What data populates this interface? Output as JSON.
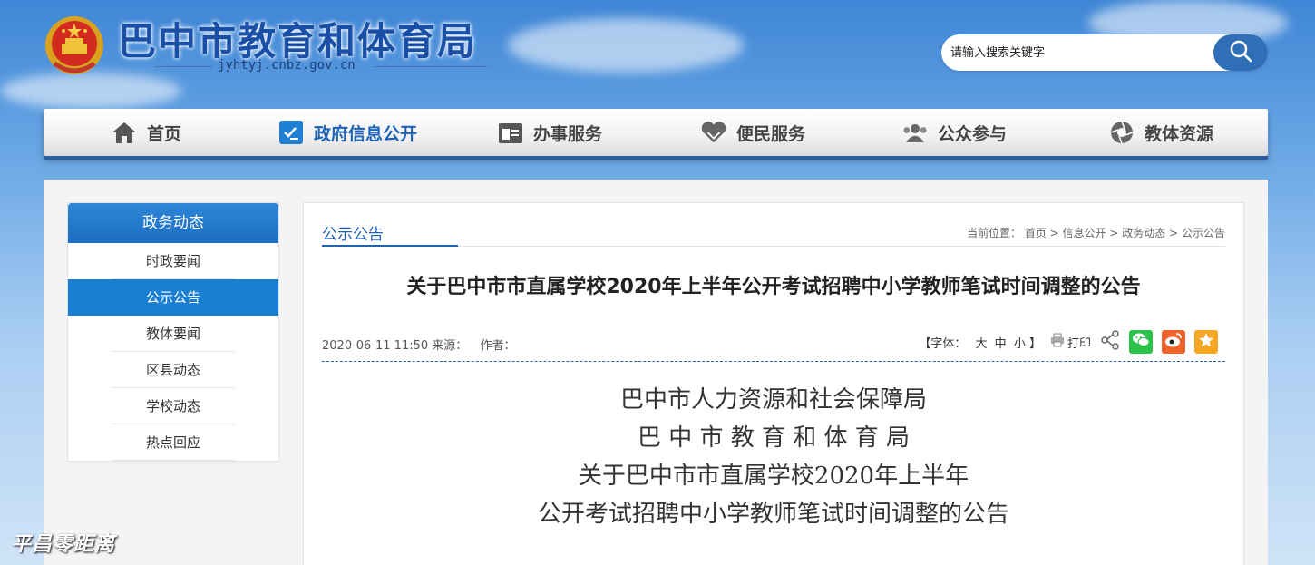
{
  "header": {
    "site_title": "巴中市教育和体育局",
    "site_domain": "jyhtyj.cnbz.gov.cn",
    "emblem_icon": "national-emblem-icon",
    "search": {
      "placeholder": "请输入搜索关键字",
      "button_icon": "search-icon"
    }
  },
  "nav": {
    "items": [
      {
        "label": "首页",
        "icon": "home-icon",
        "active": false
      },
      {
        "label": "政府信息公开",
        "icon": "doc-check-icon",
        "active": true
      },
      {
        "label": "办事服务",
        "icon": "folder-icon",
        "active": false
      },
      {
        "label": "便民服务",
        "icon": "heart-hands-icon",
        "active": false
      },
      {
        "label": "公众参与",
        "icon": "users-icon",
        "active": false
      },
      {
        "label": "教体资源",
        "icon": "aperture-icon",
        "active": false
      }
    ]
  },
  "sidebar": {
    "heading": "政务动态",
    "items": [
      {
        "label": "时政要闻",
        "active": false
      },
      {
        "label": "公示公告",
        "active": true
      },
      {
        "label": "教体要闻",
        "active": false
      },
      {
        "label": "区县动态",
        "active": false
      },
      {
        "label": "学校动态",
        "active": false
      },
      {
        "label": "热点回应",
        "active": false
      }
    ]
  },
  "content": {
    "tab_label": "公示公告",
    "breadcrumb": {
      "prefix": "当前位置：",
      "items": [
        "首页",
        "信息公开",
        "政务动态",
        "公示公告"
      ],
      "separator": " > "
    },
    "article_title": "关于巴中市市直属学校2020年上半年公开考试招聘中小学教师笔试时间调整的公告",
    "meta": {
      "date": "2020-06-11 11:50",
      "source_label": "来源：",
      "author_label": "作者："
    },
    "font_size": {
      "label": "【字体：",
      "large": "大",
      "medium": "中",
      "small": "小",
      "close": "】"
    },
    "print_label": "打印",
    "body_lines": [
      "巴中市人力资源和社会保障局",
      "巴 中 市 教 育 和 体 育 局",
      "关于巴中市市直属学校2020年上半年",
      "公开考试招聘中小学教师笔试时间调整的公告"
    ]
  },
  "watermark": "平昌零距离",
  "colors": {
    "accent": "#1f63b6",
    "wechat": "#2cc14a",
    "weibo": "#f0642b",
    "star": "#f5a623"
  }
}
